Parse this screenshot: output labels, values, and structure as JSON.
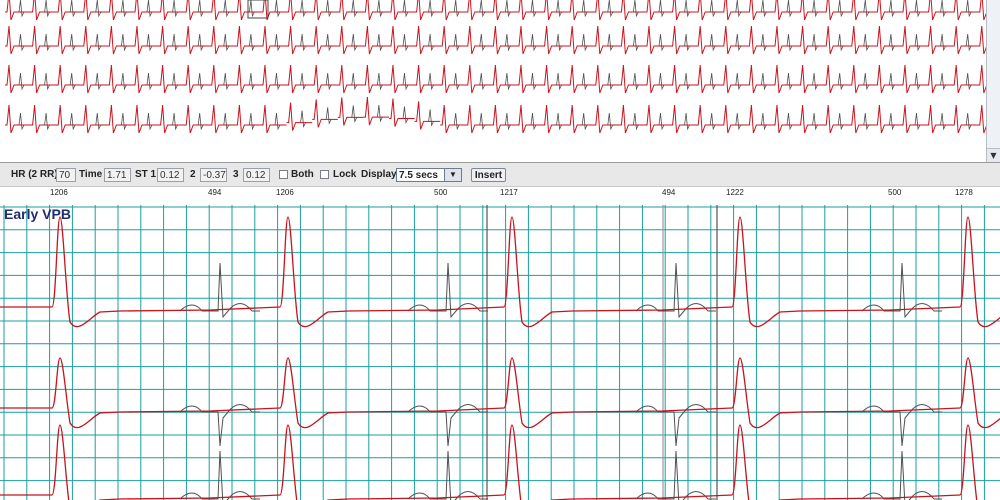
{
  "overview": {
    "trace_colors": {
      "primary": "#c8141e",
      "secondary": "#505050"
    },
    "trace_count": 4
  },
  "scrollbar": {
    "down_arrow_icon": "triangle-down-icon",
    "down_arrow_glyph": "▼"
  },
  "toolbar": {
    "hr_label": "HR (2 RR)",
    "hr_value": "70",
    "time_label": "Time",
    "time_value": "1.71",
    "st1_label": "ST 1",
    "st1_value": "0.12",
    "st2_label": "2",
    "st2_value": "-0.37",
    "st3_label": "3",
    "st3_value": "0.12",
    "both_label": "Both",
    "both_checked": false,
    "lock_label": "Lock",
    "lock_checked": false,
    "display_label": "Display",
    "display_value": "7.5 secs",
    "dropdown_icon": "triangle-down-icon",
    "dropdown_glyph": "▼",
    "insert_label": "Insert"
  },
  "beat_labels": [
    "1206",
    "494",
    "1206",
    "500",
    "1217",
    "494",
    "1222",
    "500",
    "1278"
  ],
  "detail": {
    "title": "Early VPB",
    "grid_color": "#1a9fa0",
    "trace_colors": {
      "primary": "#c8141e",
      "secondary": "#505050"
    },
    "trace_count": 3
  }
}
